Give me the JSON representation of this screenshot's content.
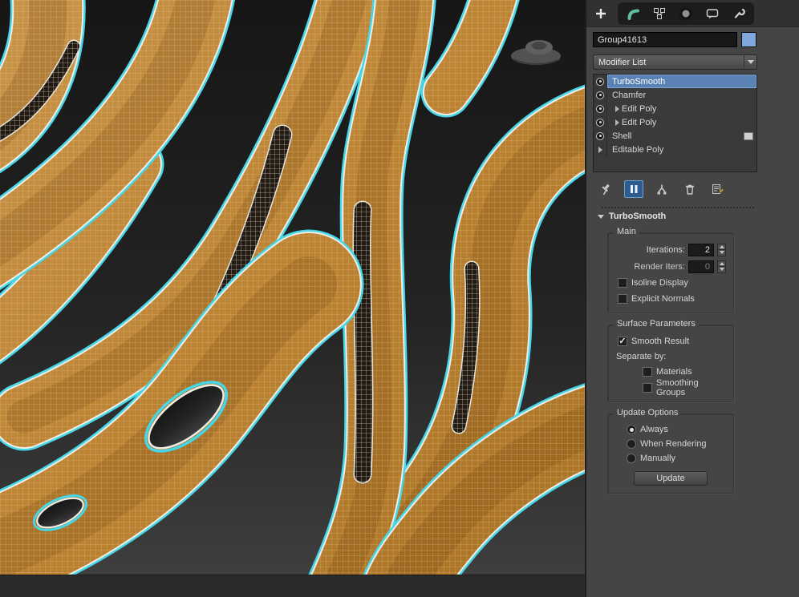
{
  "command_panel": {
    "tabs": [
      {
        "name": "create-tab",
        "icon": "plus-icon"
      },
      {
        "name": "modify-tab",
        "icon": "modify-pipe-icon"
      },
      {
        "name": "hierarchy-tab",
        "icon": "hierarchy-icon"
      },
      {
        "name": "motion-tab",
        "icon": "motion-icon"
      },
      {
        "name": "display-tab",
        "icon": "display-icon"
      },
      {
        "name": "utilities-tab",
        "icon": "wrench-icon"
      }
    ],
    "object_name": "Group41613",
    "modifier_list": {
      "label": "Modifier List"
    },
    "modifier_stack": [
      {
        "label": "TurboSmooth",
        "eye": true,
        "selected": true
      },
      {
        "label": "Chamfer",
        "eye": true
      },
      {
        "label": "Edit Poly",
        "eye": true,
        "expand": true
      },
      {
        "label": "Edit Poly",
        "eye": true,
        "expand": true
      },
      {
        "label": "Shell",
        "eye": true,
        "swatch": true
      },
      {
        "label": "Editable Poly",
        "expand": true
      }
    ],
    "stack_tools": [
      {
        "name": "pin-stack"
      },
      {
        "name": "show-end-result",
        "active": true
      },
      {
        "name": "make-unique"
      },
      {
        "name": "remove-modifier"
      },
      {
        "name": "configure-modifier-sets"
      }
    ],
    "rollout": {
      "title": "TurboSmooth",
      "main": {
        "label": "Main",
        "iterations_label": "Iterations:",
        "iterations_value": "2",
        "render_iters_label": "Render Iters:",
        "render_iters_value": "0",
        "render_iters_enabled": false,
        "isoline_display_label": "Isoline Display",
        "isoline_display_checked": false,
        "explicit_normals_label": "Explicit Normals",
        "explicit_normals_checked": false
      },
      "surface_parameters": {
        "label": "Surface Parameters",
        "smooth_result_label": "Smooth Result",
        "smooth_result_checked": true,
        "separate_by_label": "Separate by:",
        "materials_label": "Materials",
        "materials_checked": false,
        "smoothing_groups_label": "Smoothing Groups",
        "smoothing_groups_checked": false
      },
      "update_options": {
        "label": "Update Options",
        "options": [
          "Always",
          "When Rendering",
          "Manually"
        ],
        "selected_option": "Always",
        "update_button": "Update"
      }
    }
  },
  "viewport": {
    "watermark_icon": "autodesk-3dsmax-logo-watermark",
    "selected_object": "Group41613"
  },
  "colors": {
    "mesh_orange": "#bb8233",
    "selection_outline_cyan": "#45d6e8",
    "shell_edge_white": "#f0ede4",
    "stack_selection_blue": "#5b82b5",
    "active_tool_blue": "#2d5d8e",
    "object_color_swatch": "#7fa8dd",
    "panel_background": "#454545",
    "viewport_background_top": "#161616",
    "viewport_background_bottom": "#3e3e3e"
  }
}
